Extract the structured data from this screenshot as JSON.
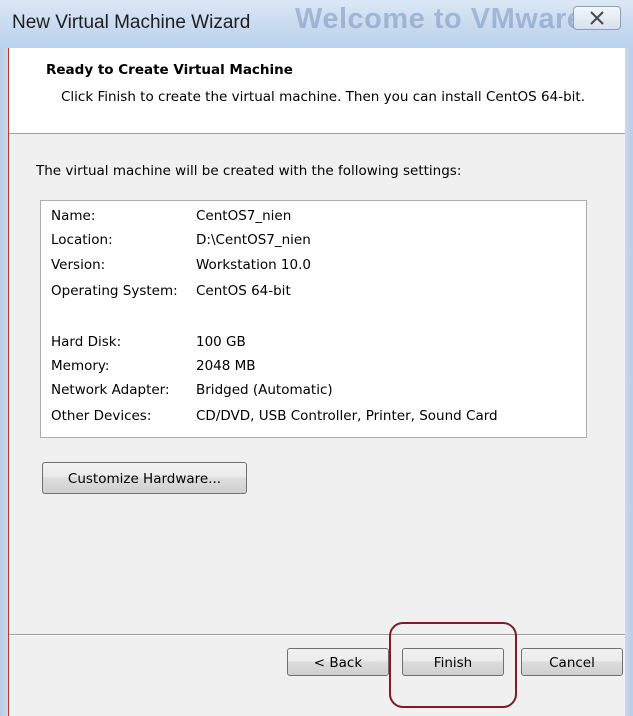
{
  "window": {
    "title": "New Virtual Machine Wizard",
    "background_window_title": "Welcome to VMware"
  },
  "header": {
    "title": "Ready to Create Virtual Machine",
    "description": "Click Finish to create the virtual machine. Then you can install CentOS 64-bit."
  },
  "main": {
    "intro": "The virtual machine will be created with the following settings:",
    "settings": [
      {
        "label": "Name:",
        "value": "CentOS7_nien"
      },
      {
        "label": "Location:",
        "value": "D:\\CentOS7_nien"
      },
      {
        "label": "Version:",
        "value": "Workstation 10.0"
      },
      {
        "label": "Operating System:",
        "value": "CentOS 64-bit"
      },
      {
        "label": "Hard Disk:",
        "value": "100 GB"
      },
      {
        "label": "Memory:",
        "value": "2048 MB"
      },
      {
        "label": "Network Adapter:",
        "value": "Bridged (Automatic)"
      },
      {
        "label": "Other Devices:",
        "value": "CD/DVD, USB Controller, Printer, Sound Card"
      }
    ],
    "customize_label": "Customize Hardware..."
  },
  "footer": {
    "back_label": "< Back",
    "finish_label": "Finish",
    "cancel_label": "Cancel"
  },
  "icons": {
    "close": "close-icon"
  },
  "colors": {
    "titlebar": "#c6d9ef",
    "highlight_annotation": "#7a1d25",
    "window_edge": "#c0362b"
  }
}
